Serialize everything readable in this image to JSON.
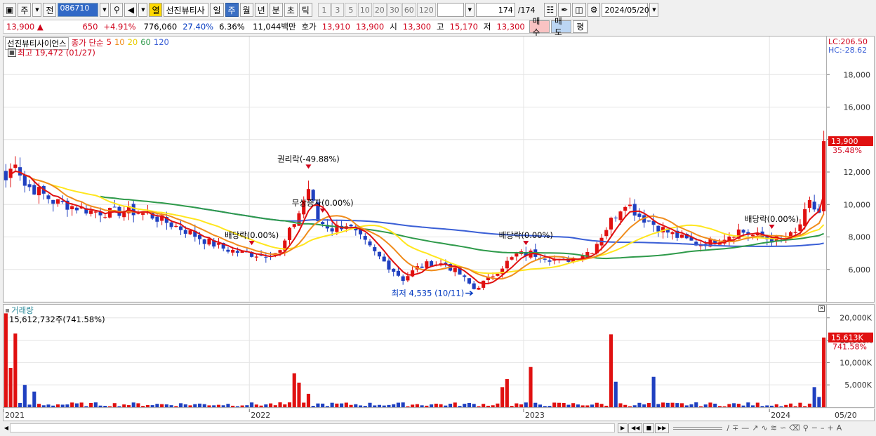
{
  "toolbar": {
    "period_main": "주",
    "prev_label": "전",
    "code": "086710",
    "stock_name": "선진뷰티사",
    "link_label": "열",
    "periods": [
      "일",
      "주",
      "월",
      "년",
      "분",
      "초",
      "틱"
    ],
    "active_period": "주",
    "intervals": [
      "1",
      "3",
      "5",
      "10",
      "20",
      "30",
      "60",
      "120"
    ],
    "count": "174",
    "count_total": "/174",
    "date": "2024/05/20"
  },
  "quote": {
    "price": "13,900",
    "change_arrow": "▲",
    "change": "650",
    "change_pct": "+4.91%",
    "volume": "776,060",
    "turnover_pct": "27.40%",
    "ratio": "6.36%",
    "amount": "11,044백만",
    "bid_label": "호가",
    "ask": "13,910",
    "bid": "13,900",
    "open_label": "시",
    "open": "13,300",
    "high_label": "고",
    "high": "15,170",
    "low_label": "저",
    "low": "13,300",
    "buy_label": "매수",
    "sell_label": "매도",
    "avg_label": "평"
  },
  "price_panel": {
    "stock_label": "선진뷰티사이언스",
    "ma_label": "종가 단순",
    "ma_periods": [
      "5",
      "10",
      "20",
      "60",
      "120"
    ],
    "high_note": "최고 19,472 (01/27)",
    "low_note": "최저 4,535 (10/11)",
    "rights_label": "권리락(-49.88%)",
    "capital_label": "무상증자(0.00%)",
    "dividend_label": "배당락(0.00%)",
    "lc": "LC:206.50",
    "hc": "HC:-28.62",
    "current_price": "13,900",
    "current_pct": "35.48%",
    "colors": {
      "ma5": "#e01010",
      "ma10": "#f08c1c",
      "ma20": "#ffe61e",
      "ma60": "#2e9a4a",
      "ma120": "#3a5fd6",
      "up": "#e01010",
      "down": "#2040c0"
    }
  },
  "volume_panel": {
    "title": "거래량",
    "max_note": "15,612,732주(741.58%)",
    "current": "15.613K",
    "current_pct": "741.58%"
  },
  "x_axis": {
    "labels": [
      "2021",
      "2022",
      "2023",
      "2024"
    ],
    "end_label": "05/20"
  },
  "chart_data": [
    {
      "type": "candlestick",
      "ylim": [
        4000,
        20000
      ],
      "y_ticks": [
        4000,
        6000,
        8000,
        10000,
        12000,
        14000,
        16000,
        18000
      ],
      "y_tick_labels": [
        "4,000",
        "6,000",
        "8,000",
        "10,000",
        "12,000",
        "14,000",
        "16,000",
        "18,000"
      ],
      "years": [
        "2021",
        "2022",
        "2023",
        "2024"
      ],
      "close_path": [
        [
          0,
          11500
        ],
        [
          2,
          12800
        ],
        [
          4,
          11200
        ],
        [
          7,
          10800
        ],
        [
          10,
          10200
        ],
        [
          14,
          9900
        ],
        [
          18,
          9600
        ],
        [
          22,
          9500
        ],
        [
          26,
          9600
        ],
        [
          30,
          9400
        ],
        [
          34,
          8900
        ],
        [
          38,
          8400
        ],
        [
          42,
          7800
        ],
        [
          46,
          7300
        ],
        [
          50,
          7000
        ],
        [
          54,
          6900
        ],
        [
          58,
          7100
        ],
        [
          62,
          9500
        ],
        [
          64,
          11000
        ],
        [
          66,
          9000
        ],
        [
          69,
          8500
        ],
        [
          72,
          8800
        ],
        [
          75,
          7900
        ],
        [
          78,
          7000
        ],
        [
          81,
          6200
        ],
        [
          84,
          5400
        ],
        [
          87,
          6100
        ],
        [
          90,
          6400
        ],
        [
          93,
          6300
        ],
        [
          96,
          5700
        ],
        [
          99,
          4800
        ],
        [
          102,
          5400
        ],
        [
          105,
          6200
        ],
        [
          108,
          6900
        ],
        [
          111,
          7000
        ],
        [
          114,
          6800
        ],
        [
          117,
          6500
        ],
        [
          120,
          6700
        ],
        [
          124,
          7200
        ],
        [
          128,
          9000
        ],
        [
          131,
          10200
        ],
        [
          134,
          9300
        ],
        [
          137,
          8800
        ],
        [
          140,
          8300
        ],
        [
          143,
          7900
        ],
        [
          146,
          7600
        ],
        [
          149,
          7700
        ],
        [
          152,
          8000
        ],
        [
          155,
          8400
        ],
        [
          158,
          8100
        ],
        [
          161,
          7900
        ],
        [
          164,
          7800
        ],
        [
          167,
          8200
        ],
        [
          170,
          10000
        ],
        [
          172,
          9500
        ],
        [
          173,
          13900
        ]
      ]
    },
    {
      "type": "bar",
      "title": "거래량",
      "ylim": [
        0,
        22000
      ],
      "y_ticks": [
        5000,
        10000,
        15000,
        20000
      ],
      "y_tick_labels": [
        "5,000K",
        "10,000K",
        "15,000K",
        "20,000K"
      ],
      "spikes": [
        [
          0,
          21000
        ],
        [
          1,
          8800
        ],
        [
          2,
          16500
        ],
        [
          4,
          5000
        ],
        [
          6,
          3500
        ],
        [
          61,
          7600
        ],
        [
          62,
          5500
        ],
        [
          64,
          3000
        ],
        [
          105,
          4500
        ],
        [
          106,
          6300
        ],
        [
          111,
          9000
        ],
        [
          128,
          16300
        ],
        [
          129,
          5700
        ],
        [
          137,
          6800
        ],
        [
          171,
          4500
        ],
        [
          172,
          2300
        ],
        [
          173,
          15600
        ]
      ]
    }
  ]
}
